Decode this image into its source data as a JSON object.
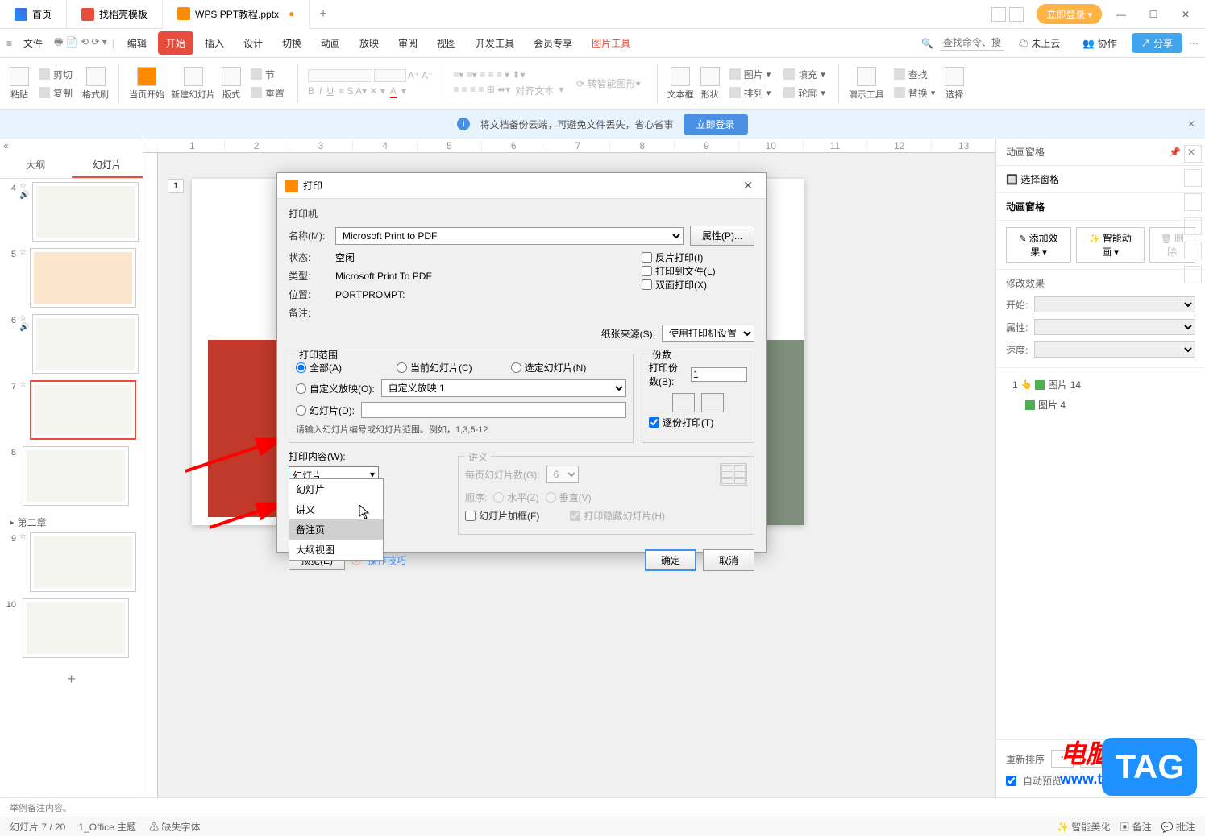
{
  "titlebar": {
    "tabs": [
      {
        "label": "首页",
        "icon": "home"
      },
      {
        "label": "找稻壳模板",
        "icon": "template"
      },
      {
        "label": "WPS PPT教程.pptx",
        "icon": "ppt",
        "active": true
      }
    ],
    "login": "立即登录"
  },
  "menubar": {
    "file": "文件",
    "items": [
      "编辑",
      "开始",
      "插入",
      "设计",
      "切换",
      "动画",
      "放映",
      "审阅",
      "视图",
      "开发工具",
      "会员专享",
      "图片工具"
    ],
    "active_index": 1,
    "highlight_index": 11,
    "search_placeholder": "查找命令、搜索模板",
    "cloud": "未上云",
    "coop": "协作",
    "share": "分享"
  },
  "toolbar": {
    "paste": "粘贴",
    "cut": "剪切",
    "copy": "复制",
    "format_painter": "格式刷",
    "from_current": "当页开始",
    "new_slide": "新建幻灯片",
    "layout": "版式",
    "section": "节",
    "reset": "重置",
    "textbox": "文本框",
    "shape": "形状",
    "picture": "图片",
    "arrange": "排列",
    "fill": "填充",
    "outline": "轮廓",
    "smart_graphic": "转智能图形",
    "align_text": "对齐文本",
    "demo_tools": "演示工具",
    "find_replace": "查找",
    "replace": "替换",
    "select": "选择"
  },
  "info_bar": {
    "text": "将文档备份云端，可避免文件丢失，省心省事",
    "button": "立即登录"
  },
  "sidebar": {
    "tabs": [
      "大纲",
      "幻灯片"
    ],
    "active_tab": 1,
    "section": "第二章",
    "slides": [
      {
        "num": "4"
      },
      {
        "num": "5"
      },
      {
        "num": "6"
      },
      {
        "num": "7",
        "selected": true
      },
      {
        "num": "8"
      },
      {
        "num": "9"
      },
      {
        "num": "10"
      }
    ]
  },
  "canvas": {
    "page_indicator": "1"
  },
  "right_panel": {
    "title": "动画窗格",
    "select_window": "选择窗格",
    "pane_title": "动画窗格",
    "add_effect": "添加效果",
    "smart_anim": "智能动画",
    "delete": "删除",
    "modify_effect": "修改效果",
    "start_label": "开始:",
    "property_label": "属性:",
    "speed_label": "速度:",
    "tree": [
      {
        "idx": "1",
        "name": "图片 14"
      },
      {
        "idx": "",
        "name": "图片 4"
      }
    ],
    "reorder": "重新排序",
    "auto_preview": "自动预览"
  },
  "notes": "举例备注内容。",
  "status": {
    "slide": "幻灯片 7 / 20",
    "theme": "1_Office 主题",
    "missing_font": "缺失字体",
    "smart_beautify": "智能美化",
    "notes": "备注",
    "comments": "批注"
  },
  "dialog": {
    "title": "打印",
    "printer_section": "打印机",
    "name_label": "名称(M):",
    "name_value": "Microsoft Print to PDF",
    "properties": "属性(P)...",
    "status_label": "状态:",
    "status_value": "空闲",
    "type_label": "类型:",
    "type_value": "Microsoft Print To PDF",
    "where_label": "位置:",
    "where_value": "PORTPROMPT:",
    "comment_label": "备注:",
    "reverse_print": "反片打印(I)",
    "print_to_file": "打印到文件(L)",
    "duplex": "双面打印(X)",
    "paper_source_label": "纸张来源(S):",
    "paper_source_value": "使用打印机设置",
    "range_section": "打印范围",
    "range_all": "全部(A)",
    "range_current": "当前幻灯片(C)",
    "range_selected": "选定幻灯片(N)",
    "range_custom": "自定义放映(O):",
    "range_custom_value": "自定义放映 1",
    "range_slides": "幻灯片(D):",
    "range_hint": "请输入幻灯片编号或幻灯片范围。例如，1,3,5-12",
    "copies_section": "份数",
    "copies_label": "打印份数(B):",
    "copies_value": "1",
    "collate": "逐份打印(T)",
    "content_label": "打印内容(W):",
    "content_value": "幻灯片",
    "content_options": [
      "幻灯片",
      "讲义",
      "备注页",
      "大纲视图"
    ],
    "content_hover_index": 2,
    "handout_section": "讲义",
    "per_page_label": "每页幻灯片数(G):",
    "per_page_value": "6",
    "order_label": "顺序:",
    "order_h": "水平(Z)",
    "order_v": "垂直(V)",
    "frame": "幻灯片加框(F)",
    "hidden": "打印隐藏幻灯片(H)",
    "preview": "预览(E)",
    "tips": "操作技巧",
    "ok": "确定",
    "cancel": "取消"
  },
  "watermark": {
    "line1": "电脑技术网",
    "line2": "www.tagxp.com"
  },
  "tag": "TAG"
}
